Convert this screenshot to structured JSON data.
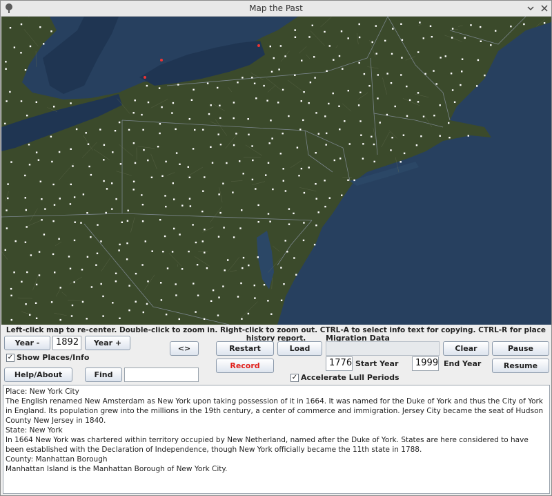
{
  "window": {
    "title": "Map the Past"
  },
  "icons": {
    "app": "tree-icon",
    "minimize": "chevron-down-icon",
    "close": "close-icon"
  },
  "hint": "Left-click map to re-center. Double-click to zoom in. Right-click to zoom out. CTRL-A to select info text for copying. CTRL-R for place history report.",
  "controls": {
    "year_minus": "Year -",
    "year_value": "1892",
    "year_plus": "Year +",
    "show_places": "Show Places/Info",
    "swap": "<>",
    "help": "Help/About",
    "find": "Find",
    "find_value": ""
  },
  "migration": {
    "title": "Migration Data",
    "restart": "Restart",
    "load": "Load",
    "record": "Record",
    "clear": "Clear",
    "pause": "Pause",
    "resume": "Resume",
    "start_year": "1776",
    "start_label": "Start Year",
    "end_year": "1999",
    "end_label": "End Year",
    "accelerate": "Accelerate Lull Periods"
  },
  "info": [
    "Place: New York City",
    "The English renamed New Amsterdam as New York upon taking possession of it in 1664.  It was named for the Duke of York and thus the City of York in England.  Its population grew into the millions in the 19th century, a center of commerce and immigration.  Jersey City became the seat of Hudson County New Jersey in 1840.",
    "State: New York",
    "In 1664 New York was chartered within territory occupied by New Netherland, named after the Duke of York.  States are here considered to have been established with the Declaration of Independence, though New York officially became the 11th state in 1788.",
    "County: Manhattan Borough",
    "Manhattan Island is the Manhattan Borough of New York City."
  ],
  "colors": {
    "ocean": "#27405f",
    "lake": "#1f3552",
    "land": "#3a4a2a",
    "record_text": "#e0201b"
  }
}
